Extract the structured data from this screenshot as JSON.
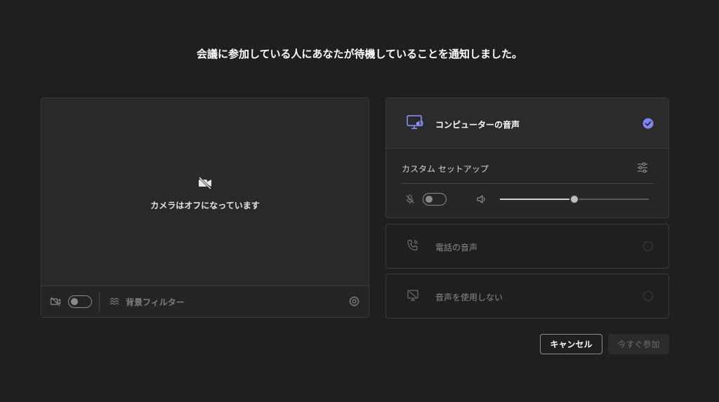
{
  "header": {
    "title": "会議に参加している人にあなたが待機していることを通知しました。"
  },
  "video": {
    "camera_off_text": "カメラはオフになっています",
    "camera_toggle": "off",
    "background_filter_label": "背景フィルター"
  },
  "audio": {
    "computer_audio_label": "コンピューターの音声",
    "computer_audio_selected": true,
    "custom_setup_label": "カスタム セットアップ",
    "mic_toggle": "off",
    "speaker_volume_percent": 50,
    "phone_audio_label": "電話の音声",
    "no_audio_label": "音声を使用しない"
  },
  "buttons": {
    "cancel_label": "キャンセル",
    "join_label": "今すぐ参加"
  },
  "colors": {
    "background": "#1f1f1f",
    "accent": "#7f85f5",
    "disabled_text": "#6e6e6e"
  }
}
